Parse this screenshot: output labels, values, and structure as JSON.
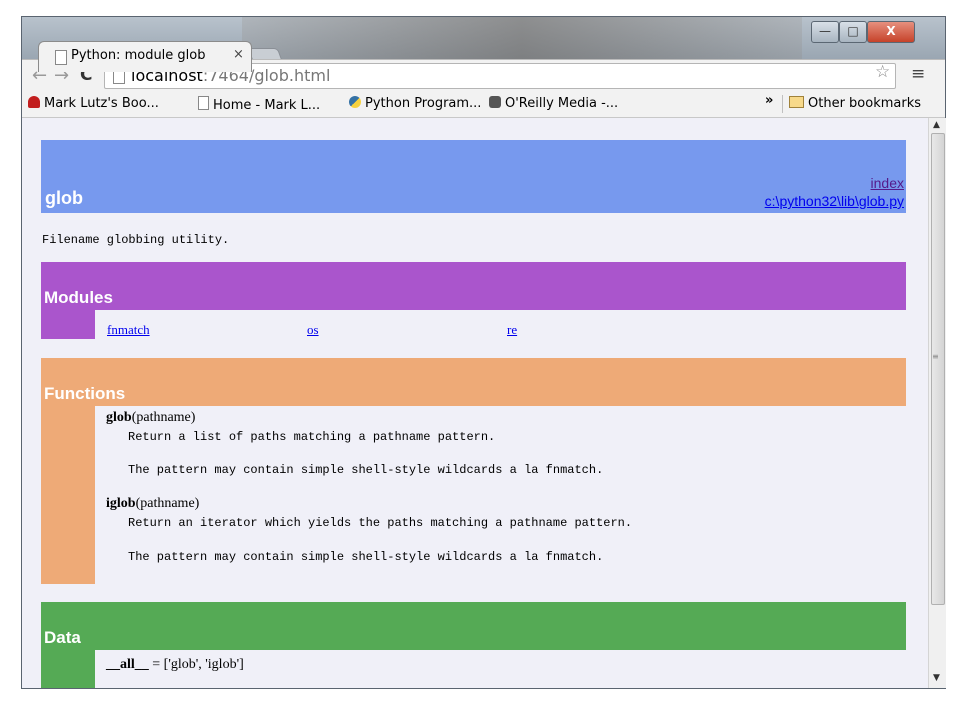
{
  "browser": {
    "tab_title": "Python: module glob",
    "tab_close": "×",
    "window_controls": {
      "minimize": "—",
      "maximize": "□",
      "close": "X"
    },
    "url_host": "localhost",
    "url_rest": ":7464/glob.html",
    "nav": {
      "back": "←",
      "forward": "→",
      "reload": "C"
    },
    "star_icon": "☆",
    "menu_icon": "≡",
    "bookmarks": [
      {
        "label": "Mark Lutz's Boo...",
        "icon": "red-bookmark-icon"
      },
      {
        "label": "Home - Mark L...",
        "icon": "page-icon"
      },
      {
        "label": "Python Program...",
        "icon": "python-icon"
      },
      {
        "label": "O'Reilly Media -...",
        "icon": "oreilly-icon"
      }
    ],
    "bookmarks_more": "»",
    "other_bookmarks": "Other bookmarks"
  },
  "page": {
    "module_title": "glob",
    "index_link": "index",
    "source_link": "c:\\python32\\lib\\glob.py",
    "doc": "Filename globbing utility.",
    "modules_title": "Modules",
    "modules": [
      "fnmatch",
      "os",
      "re"
    ],
    "functions_title": "Functions",
    "functions": [
      {
        "name": "glob",
        "args": "(pathname)",
        "doc1": "Return a list of paths matching a pathname pattern.",
        "doc2": "The pattern may contain simple shell-style wildcards a la fnmatch."
      },
      {
        "name": "iglob",
        "args": "(pathname)",
        "doc1": "Return an iterator which yields the paths matching a pathname pattern.",
        "doc2": "The pattern may contain simple shell-style wildcards a la fnmatch."
      }
    ],
    "data_title": "Data",
    "data_name": "__all__",
    "data_value": " = ['glob', 'iglob']"
  }
}
